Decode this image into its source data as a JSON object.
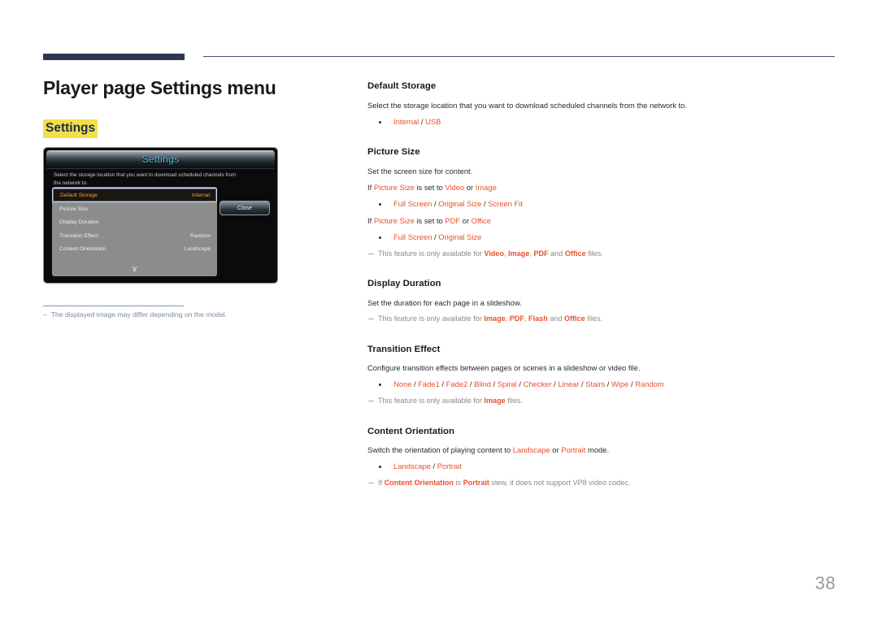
{
  "page": {
    "title": "Player page Settings menu",
    "section_tag": "Settings",
    "number": "38"
  },
  "osd": {
    "title": "Settings",
    "description": "Select the storage location that you want to download scheduled channels from the network to.",
    "close_label": "Close",
    "chevron": "∨",
    "rows": [
      {
        "label": "Default Storage",
        "value": "Internal",
        "selected": true
      },
      {
        "label": "Picture Size",
        "value": "",
        "selected": false
      },
      {
        "label": "Display Duration",
        "value": "",
        "selected": false
      },
      {
        "label": "Transition Effect",
        "value": "Random",
        "selected": false
      },
      {
        "label": "Content Orientation",
        "value": "Landscape",
        "selected": false
      }
    ]
  },
  "caption": {
    "dash": "–",
    "text": "The displayed image may differ depending on the model."
  },
  "sections": {
    "default_storage": {
      "heading": "Default Storage",
      "body": "Select the storage location that you want to download scheduled channels from the network to.",
      "options": [
        "Internal",
        "USB"
      ]
    },
    "picture_size": {
      "heading": "Picture Size",
      "body": "Set the screen size for content.",
      "cond1_pre": "If ",
      "cond1_term": "Picture Size",
      "cond1_mid": " is set to ",
      "cond1_a": "Video",
      "cond1_or": " or ",
      "cond1_b": "Image",
      "options1": [
        "Full Screen",
        "Original Size",
        "Screen Fit"
      ],
      "cond2_pre": "If ",
      "cond2_term": "Picture Size",
      "cond2_mid": " is set to ",
      "cond2_a": "PDF",
      "cond2_or": " or ",
      "cond2_b": "Office",
      "options2": [
        "Full Screen",
        "Original Size"
      ],
      "note_pre": "This feature is only available for ",
      "note_items": [
        "Video",
        "Image",
        "PDF",
        "Office"
      ],
      "note_and": " and ",
      "note_post": " files."
    },
    "display_duration": {
      "heading": "Display Duration",
      "body": "Set the duration for each page in a slideshow.",
      "note_pre": "This feature is only available for ",
      "note_items": [
        "Image",
        "PDF",
        "Flash",
        "Office"
      ],
      "note_and": " and ",
      "note_post": " files."
    },
    "transition_effect": {
      "heading": "Transition Effect",
      "body": "Configure transition effects between pages or scenes in a slideshow or video file.",
      "options": [
        "None",
        "Fade1",
        "Fade2",
        "Blind",
        "Spiral",
        "Checker",
        "Linear",
        "Stairs",
        "Wipe",
        "Random"
      ],
      "note_pre": "This feature is only available for ",
      "note_items": [
        "Image"
      ],
      "note_post": " files."
    },
    "content_orientation": {
      "heading": "Content Orientation",
      "body_pre": "Switch the orientation of playing content to ",
      "body_a": "Landscape",
      "body_or": " or ",
      "body_b": "Portrait",
      "body_post": " mode.",
      "options": [
        "Landscape",
        "Portrait"
      ],
      "note_pre": "If ",
      "note_term": "Content Orientation",
      "note_mid": " is ",
      "note_value": "Portrait",
      "note_post": " view, it does not support VP8 video codec."
    }
  },
  "colors": {
    "accent": "#e8512f",
    "rule_navy": "#2e3650",
    "highlight": "#f2e04b",
    "note_gray": "#8a8a8a"
  }
}
